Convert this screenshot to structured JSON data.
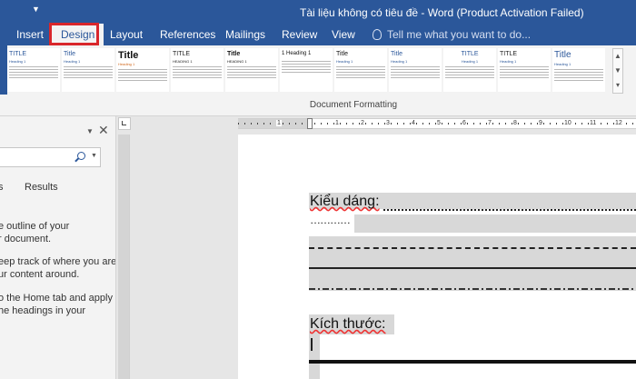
{
  "window": {
    "title": "Tài liệu không có tiêu đề  -  Word (Product Activation Failed)",
    "qat_dropdown_icon": "caret-down-icon"
  },
  "tabs": [
    {
      "label": "Insert",
      "active": false
    },
    {
      "label": "Design",
      "active": true,
      "highlighted": true
    },
    {
      "label": "Layout",
      "active": false
    },
    {
      "label": "References",
      "active": false
    },
    {
      "label": "Mailings",
      "active": false
    },
    {
      "label": "Review",
      "active": false
    },
    {
      "label": "View",
      "active": false
    }
  ],
  "tell_me": {
    "placeholder": "Tell me what you want to do...",
    "icon": "lightbulb-icon"
  },
  "ribbon": {
    "group_label": "Document Formatting",
    "style_gallery": [
      {
        "title": "TITLE",
        "heading": "Heading 1"
      },
      {
        "title": "Title",
        "heading": "Heading 1"
      },
      {
        "title": "Title",
        "heading": "Heading 1"
      },
      {
        "title": "TITLE",
        "heading": "HEADING 1"
      },
      {
        "title": "Title",
        "heading": "HEADING 1"
      },
      {
        "title": "1   Heading 1",
        "heading": ""
      },
      {
        "title": "Title",
        "heading": "Heading 1"
      },
      {
        "title": "Title",
        "heading": "Heading 1"
      },
      {
        "title": "TITLE",
        "heading": "Heading 1"
      },
      {
        "title": "TITLE",
        "heading": "Heading 1"
      },
      {
        "title": "Title",
        "heading": "Heading 1"
      }
    ],
    "gallery_scroll_icons": [
      "chevron-up-icon",
      "chevron-down-icon",
      "more-icon"
    ]
  },
  "nav_pane": {
    "tabs": [
      "s",
      "Results"
    ],
    "text_lines": [
      "e outline of your",
      "r document.",
      "eep track of where you are",
      "ur content around.",
      "o the Home tab and apply",
      "he headings in your"
    ],
    "close_icon": "close-icon",
    "dropdown_icon": "caret-down-icon",
    "search_icon": "search-icon"
  },
  "ruler": {
    "numbers": [
      "1",
      "1",
      "2",
      "3",
      "4",
      "5",
      "6",
      "7",
      "8",
      "9",
      "10",
      "11",
      "12"
    ]
  },
  "document": {
    "heading1": "Kiểu dáng:",
    "dots": "…………",
    "heading2": "Kích thước:"
  }
}
